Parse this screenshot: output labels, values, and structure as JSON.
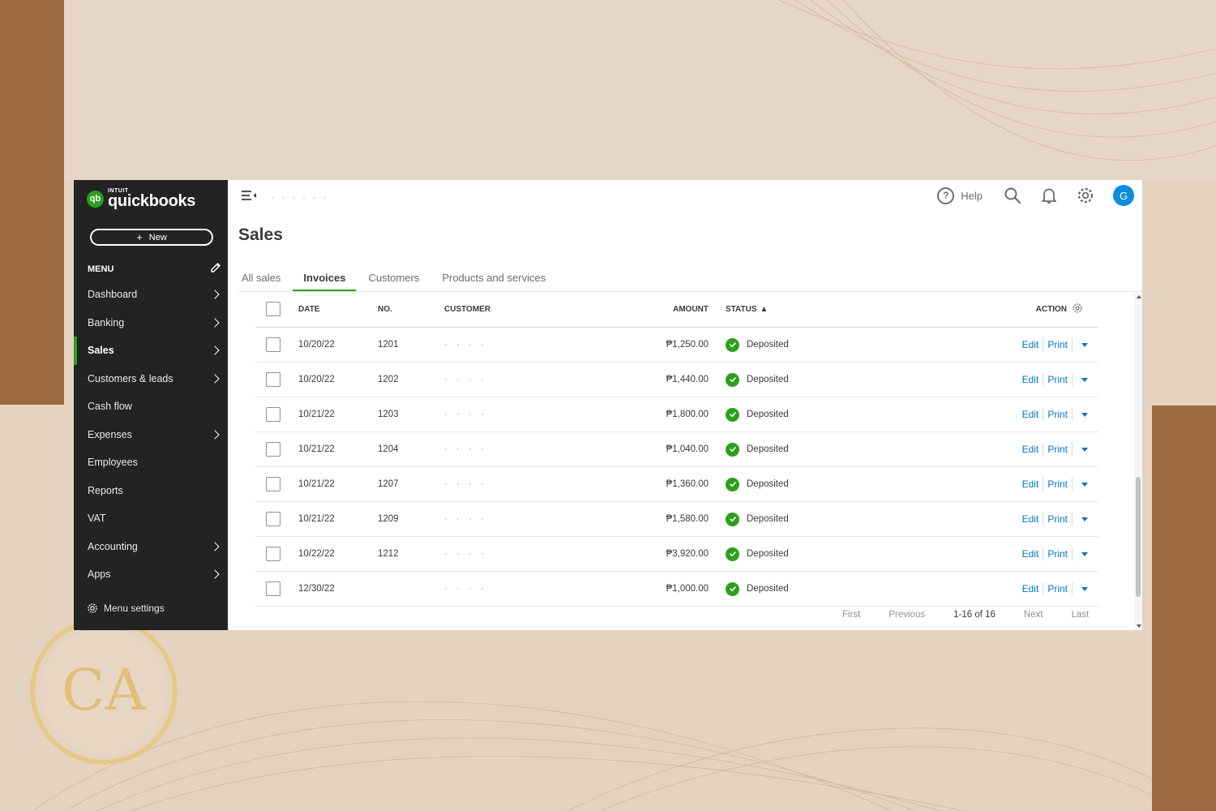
{
  "app": {
    "brand_small": "INTUIT",
    "brand_name": "quickbooks",
    "brand_mark": "qb",
    "new_button": "New",
    "menu_title": "MENU",
    "company_name": "· · · · · ·",
    "page_title": "Sales"
  },
  "sidebar": {
    "items": [
      {
        "label": "Dashboard"
      },
      {
        "label": "Banking"
      },
      {
        "label": "Sales"
      },
      {
        "label": "Customers & leads"
      },
      {
        "label": "Cash flow"
      },
      {
        "label": "Expenses"
      },
      {
        "label": "Employees"
      },
      {
        "label": "Reports"
      },
      {
        "label": "VAT"
      },
      {
        "label": "Accounting"
      },
      {
        "label": "Apps"
      }
    ],
    "menu_settings": "Menu settings"
  },
  "topbar": {
    "help_label": "Help",
    "avatar_initial": "G"
  },
  "tabs": [
    {
      "label": "All sales"
    },
    {
      "label": "Invoices"
    },
    {
      "label": "Customers"
    },
    {
      "label": "Products and services"
    }
  ],
  "table": {
    "headers": {
      "date": "DATE",
      "no": "NO.",
      "customer": "CUSTOMER",
      "amount": "AMOUNT",
      "status": "STATUS",
      "status_sort": "▲",
      "action": "ACTION"
    },
    "rows": [
      {
        "date": "10/20/22",
        "no": "1201",
        "customer": "· · · ·",
        "amount": "₱1,250.00",
        "status": "Deposited",
        "edit": "Edit",
        "print": "Print"
      },
      {
        "date": "10/20/22",
        "no": "1202",
        "customer": "· · · ·",
        "amount": "₱1,440.00",
        "status": "Deposited",
        "edit": "Edit",
        "print": "Print"
      },
      {
        "date": "10/21/22",
        "no": "1203",
        "customer": "· · · ·",
        "amount": "₱1,800.00",
        "status": "Deposited",
        "edit": "Edit",
        "print": "Print"
      },
      {
        "date": "10/21/22",
        "no": "1204",
        "customer": "· · · ·",
        "amount": "₱1,040.00",
        "status": "Deposited",
        "edit": "Edit",
        "print": "Print"
      },
      {
        "date": "10/21/22",
        "no": "1207",
        "customer": "· · · ·",
        "amount": "₱1,360.00",
        "status": "Deposited",
        "edit": "Edit",
        "print": "Print"
      },
      {
        "date": "10/21/22",
        "no": "1209",
        "customer": "· · · ·",
        "amount": "₱1,580.00",
        "status": "Deposited",
        "edit": "Edit",
        "print": "Print"
      },
      {
        "date": "10/22/22",
        "no": "1212",
        "customer": "· · · ·",
        "amount": "₱3,920.00",
        "status": "Deposited",
        "edit": "Edit",
        "print": "Print"
      },
      {
        "date": "12/30/22",
        "no": "",
        "customer": "· · · ·",
        "amount": "₱1,000.00",
        "status": "Deposited",
        "edit": "Edit",
        "print": "Print"
      }
    ]
  },
  "pager": {
    "first": "First",
    "previous": "Previous",
    "range": "1-16 of 16",
    "next": "Next",
    "last": "Last"
  },
  "colors": {
    "brand_green": "#2ca01c",
    "sidebar_bg": "#232323",
    "link_blue": "#0077c5",
    "avatar_blue": "#0d8ce0",
    "frame_brown": "#9c6b3f"
  },
  "badge": {
    "monogram": "CA"
  }
}
